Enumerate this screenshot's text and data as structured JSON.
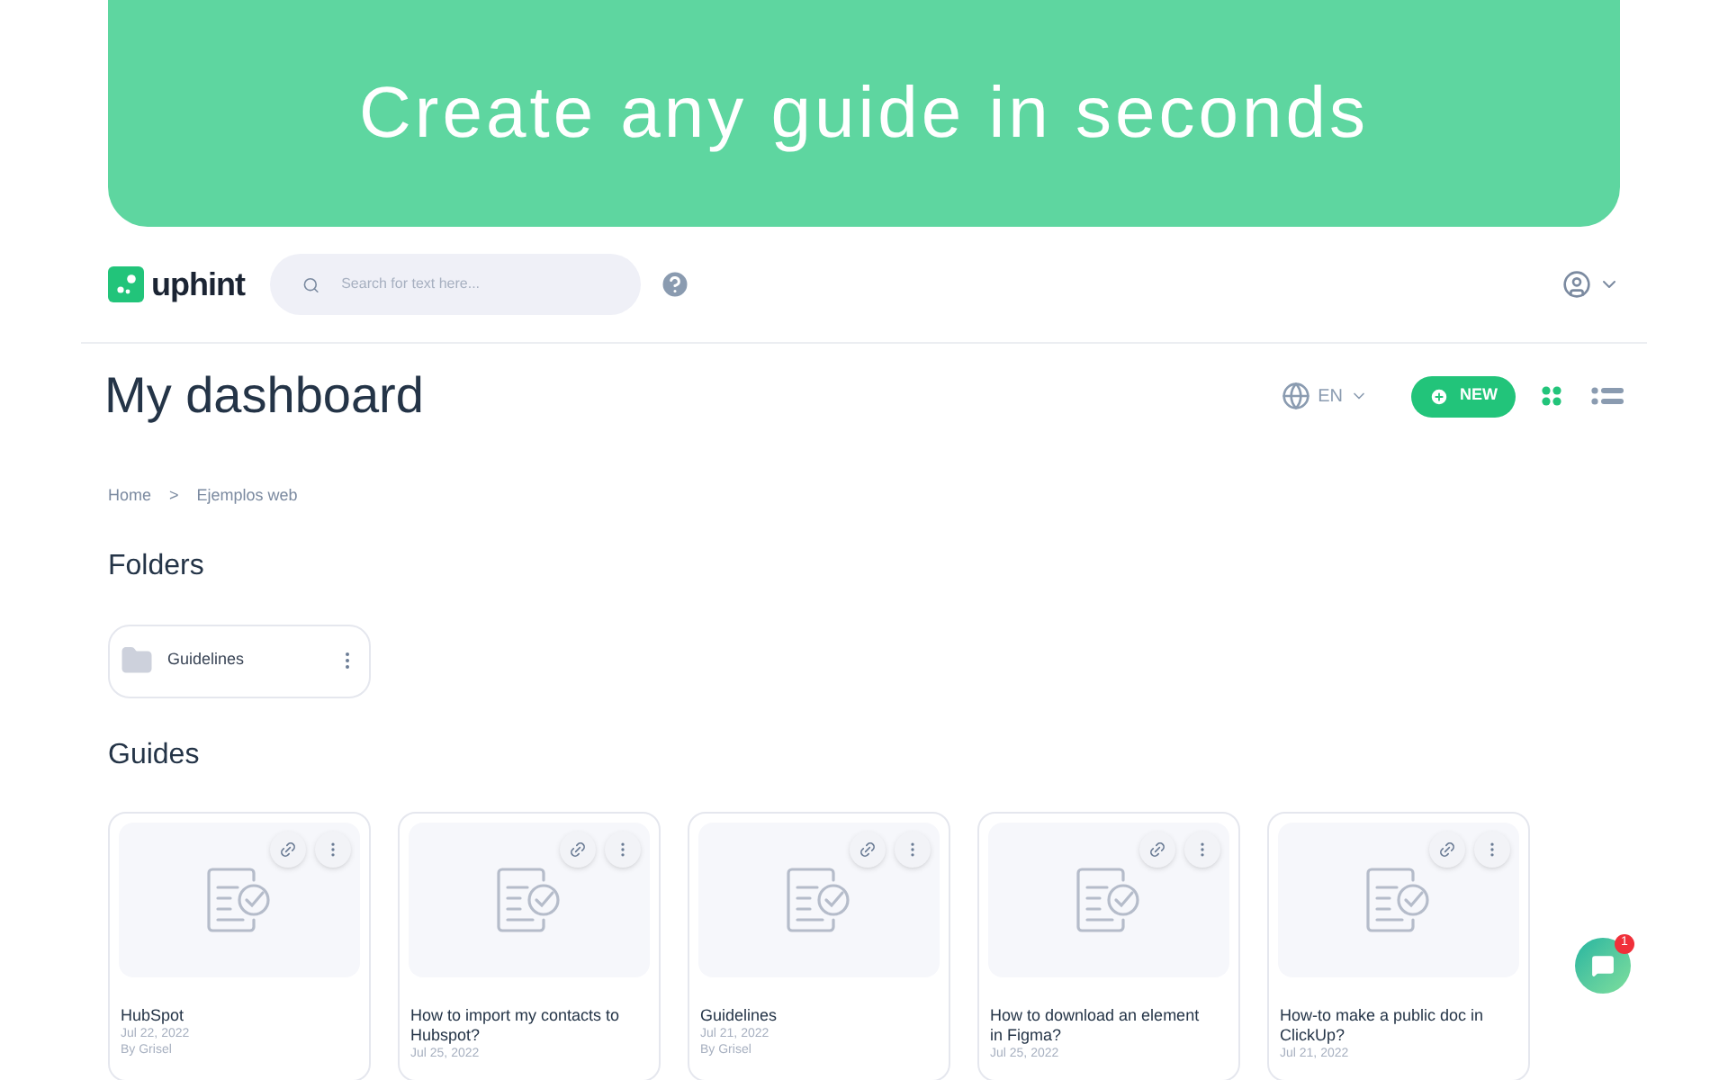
{
  "banner": {
    "title": "Create any guide in seconds"
  },
  "header": {
    "logo": "uphint",
    "search": {
      "placeholder": "Search for text here..."
    }
  },
  "page": {
    "title": "My dashboard",
    "language": "EN",
    "new_button": "NEW",
    "views": [
      {
        "kind": "grid",
        "selected": true
      },
      {
        "kind": "list",
        "selected": false
      }
    ]
  },
  "breadcrumb": [
    "Home",
    "Ejemplos web"
  ],
  "breadcrumb_separator": ">",
  "folders": {
    "heading": "Folders",
    "items": [
      {
        "name": "Guidelines"
      }
    ]
  },
  "guides": {
    "heading": "Guides",
    "items": [
      {
        "title": "HubSpot",
        "date": "Jul 22, 2022",
        "author": "By Grisel"
      },
      {
        "title": "How to import my contacts to Hubspot?",
        "date": "Jul 25, 2022"
      },
      {
        "title": "Guidelines",
        "date": "Jul 21, 2022",
        "author": "By Grisel"
      },
      {
        "title": "How to download an element in Figma?",
        "date": "Jul 25, 2022"
      },
      {
        "title": "How-to make a public doc in ClickUp?",
        "date": "Jul 21, 2022"
      }
    ]
  },
  "chat": {
    "badge": "1"
  }
}
